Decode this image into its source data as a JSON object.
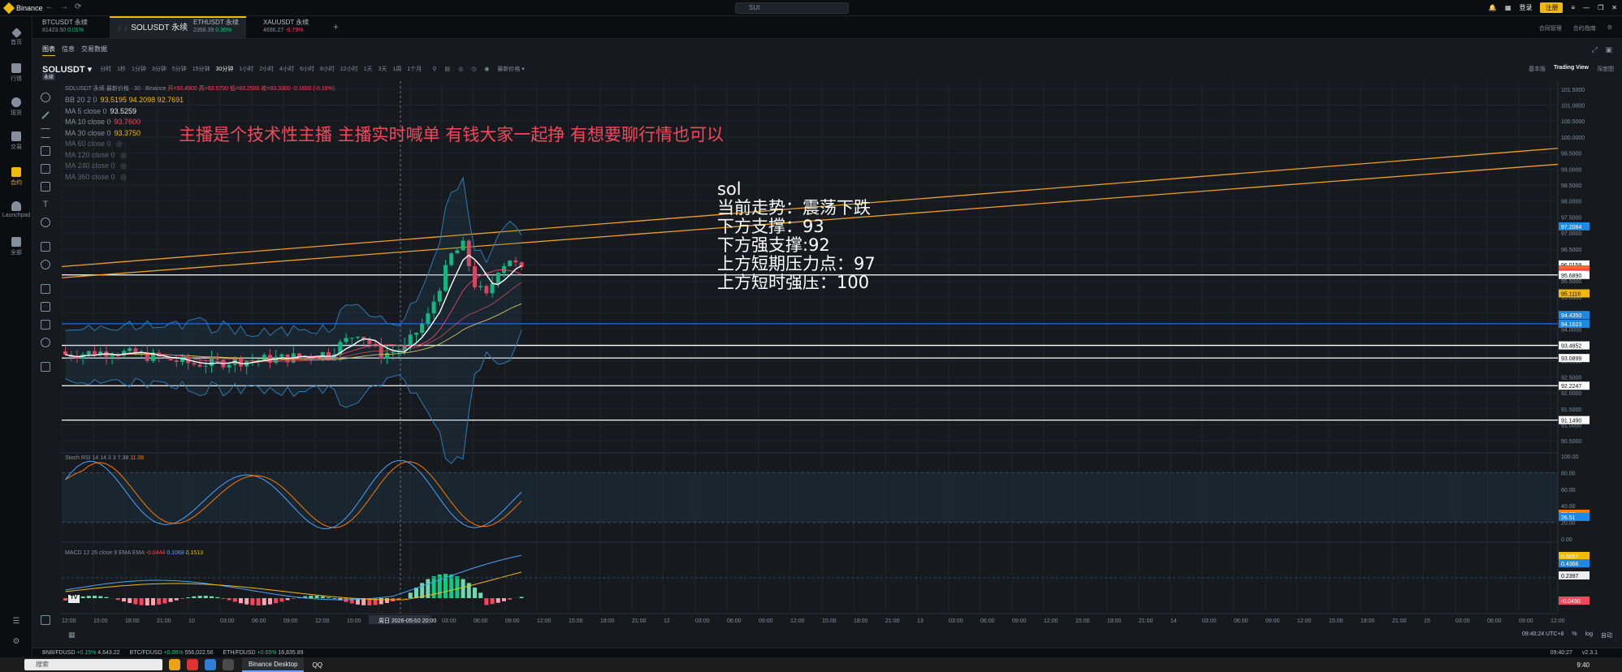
{
  "window": {
    "app_name": "Binance",
    "search_placeholder": "SUI",
    "login": "登录",
    "register": "注册"
  },
  "tabs": [
    {
      "name": "BTCUSDT 永续",
      "price": "81423.50",
      "change": "0.01%"
    },
    {
      "name": "SOLUSDT 永续",
      "active": true
    },
    {
      "name": "ETHUSDT 永续",
      "price": "2356.39",
      "change": "0.36%"
    },
    {
      "name": "XAUUSDT 永续",
      "price": "4696.27",
      "change": "-0.79%"
    }
  ],
  "topright": {
    "item1": "合同管理",
    "item2": "合约指南"
  },
  "sidebar": [
    {
      "label": "首页"
    },
    {
      "label": "行情"
    },
    {
      "label": "现货"
    },
    {
      "label": "交易"
    },
    {
      "label": "合约"
    },
    {
      "label": "Launchpad"
    },
    {
      "label": "全部"
    }
  ],
  "subtabs": [
    "图表",
    "信息",
    "交易数据"
  ],
  "toolbar": {
    "symbol": "SOLUSDT",
    "symbol_sub": "永续",
    "timeframes": [
      "分时",
      "1秒",
      "1分钟",
      "3分钟",
      "5分钟",
      "15分钟",
      "30分钟",
      "1小时",
      "2小时",
      "4小时",
      "6小时",
      "8小时",
      "12小时",
      "1天",
      "3天",
      "1周",
      "1个月"
    ],
    "active_tf": "30分钟",
    "price_type": "最新价格",
    "views": [
      "基本版",
      "Trading View",
      "深度图"
    ]
  },
  "chart": {
    "header": "SOLUSDT 永续 最新价格 · 30 · Binance",
    "ohlc": "开=93.4900 高=93.5700 低=93.2500 收=93.3300 -0.1600 (-0.16%)",
    "indicators": [
      {
        "name": "BB 20 2 0",
        "values": "93.5195  94.2098  92.7691"
      },
      {
        "name": "MA 5 close 0",
        "values": "93.5259"
      },
      {
        "name": "MA 10 close 0",
        "values": "93.7600"
      },
      {
        "name": "MA 30 close 0",
        "values": "93.3750"
      },
      {
        "name": "MA 60 close 0",
        "values": ""
      },
      {
        "name": "MA 120 close 0",
        "values": ""
      },
      {
        "name": "MA 240 close 0",
        "values": ""
      },
      {
        "name": "MA 360 close 0",
        "values": ""
      }
    ],
    "stoch": {
      "label": "Stoch RSI 14 14 3 3",
      "k": "7.38",
      "d": "11.06"
    },
    "macd": {
      "label": "MACD 12 26 close 9 EMA EMA",
      "v1": "-0.0444",
      "v2": "0.1068",
      "v3": "0.1513"
    },
    "banner": "主播是个技术性主播 主播实时喊单 有钱大家一起挣 有想要聊行情也可以",
    "note_lines": [
      "sol",
      "当前走势：震荡下跌",
      "下方支撑：93",
      "下方强支撑:92",
      "上方短期压力点：97",
      "上方短时强压：100"
    ],
    "price_axis": [
      "101.5000",
      "101.0000",
      "100.5000",
      "100.0000",
      "99.5000",
      "99.0000",
      "98.5000",
      "98.0000",
      "97.5000",
      "97.0000",
      "96.5000",
      "96.0000",
      "95.5000",
      "95.0000",
      "94.5000",
      "94.0000",
      "93.5000",
      "93.0000",
      "92.5000",
      "92.0000",
      "91.5000",
      "91.0000",
      "90.5000"
    ],
    "price_tags": [
      {
        "p": "97.2084",
        "color": "#1e88e5"
      },
      {
        "p": "96.0159",
        "color": "#ffffff"
      },
      {
        "p": "95.8570",
        "color": "#f6465d"
      },
      {
        "p": "95.8230",
        "color": "#ff7a00"
      },
      {
        "p": "95.7700",
        "color": "#f6465d"
      },
      {
        "p": "95.6890",
        "color": "#ffffff"
      },
      {
        "p": "95.1116",
        "color": "#f0b90b"
      },
      {
        "p": "94.4350",
        "color": "#1e88e5"
      },
      {
        "p": "94.1623",
        "color": "#1e88e5"
      },
      {
        "p": "93.4852",
        "color": "#ffffff"
      },
      {
        "p": "93.0899",
        "color": "#ffffff"
      },
      {
        "p": "92.2247",
        "color": "#ffffff"
      },
      {
        "p": "91.1490",
        "color": "#ffffff"
      }
    ],
    "stoch_axis": [
      "100.00",
      "80.00",
      "60.00",
      "40.00",
      "20.00",
      "0.00"
    ],
    "stoch_tags": [
      "30.37",
      "26.51"
    ],
    "macd_tags": [
      "0.5057",
      "0.4366",
      "0.2397",
      "-0.0490"
    ],
    "time_axis": [
      "12:00",
      "15:00",
      "18:00",
      "21:00",
      "10",
      "03:00",
      "06:00",
      "09:00",
      "12:00",
      "15:00",
      "周日 2026-05-10  20:00",
      "11",
      "03:00",
      "06:00",
      "09:00",
      "12:00",
      "15:00",
      "18:00",
      "21:00",
      "12",
      "03:00",
      "06:00",
      "09:00",
      "12:00",
      "15:00",
      "18:00",
      "21:00",
      "13",
      "03:00",
      "06:00",
      "09:00",
      "12:00",
      "15:00",
      "18:00",
      "21:00",
      "14",
      "03:00",
      "06:00",
      "09:00",
      "12:00",
      "15:00",
      "18:00",
      "21:00",
      "15",
      "03:00",
      "06:00",
      "09:00",
      "12:00"
    ],
    "clock": "09:40:24 UTC+8",
    "scale_opts": [
      "%",
      "log",
      "自动"
    ]
  },
  "statusbar": [
    {
      "sym": "BNB/FDUSD",
      "chg": "+0.15%",
      "price": "4,643.22"
    },
    {
      "sym": "BTC/FDUSD",
      "chg": "+0.05%",
      "price": "556,022.56"
    },
    {
      "sym": "ETH/FDUSD",
      "chg": "+0.65%",
      "price": "16,835.89"
    }
  ],
  "status_right": {
    "time": "09:40:27",
    "version": "v2.3.1"
  },
  "taskbar": {
    "search": "搜索",
    "app": "Binance Desktop",
    "app2": "QQ",
    "time": "9:40"
  }
}
